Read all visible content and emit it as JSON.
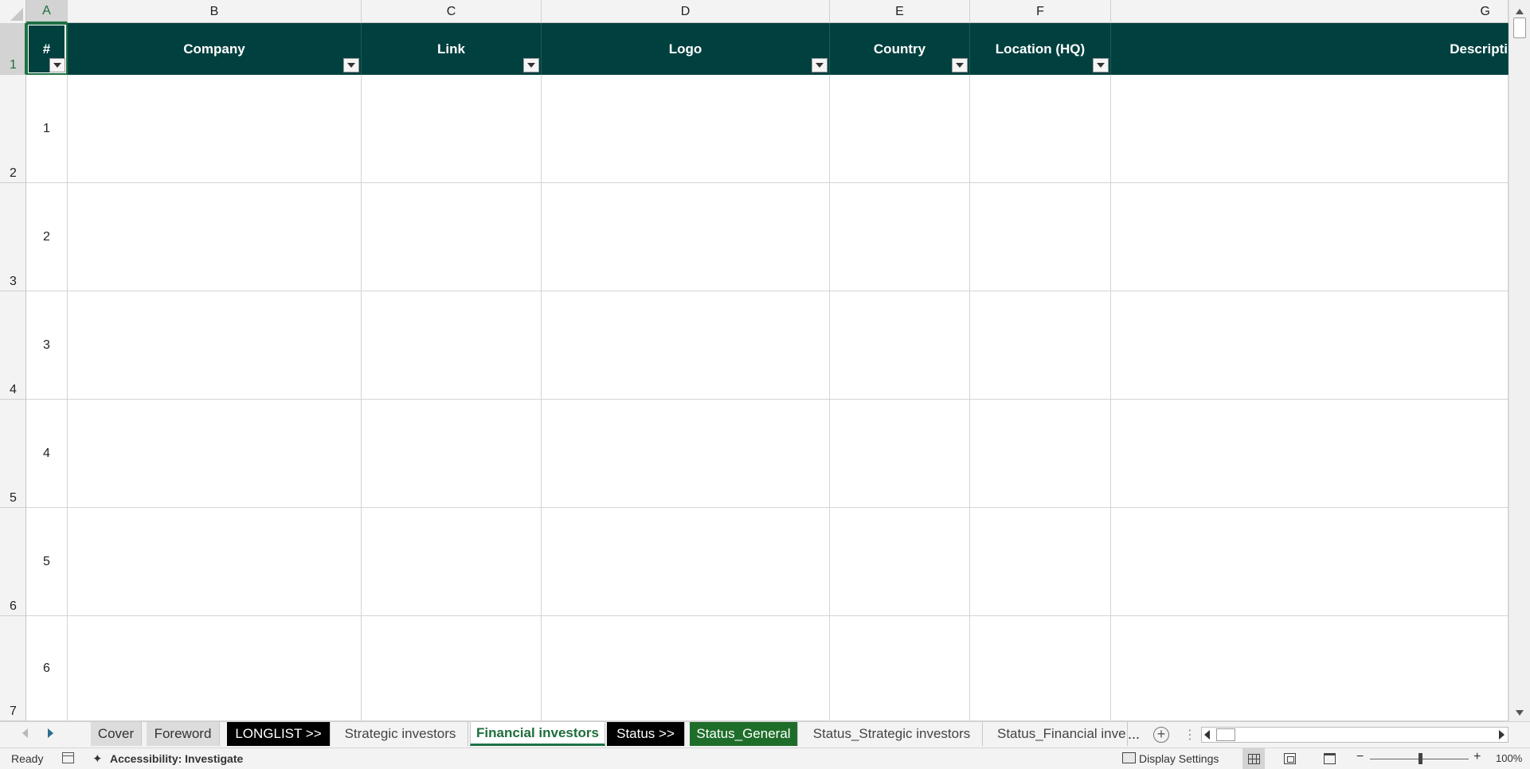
{
  "columns": [
    "A",
    "B",
    "C",
    "D",
    "E",
    "F",
    "G"
  ],
  "header_row": {
    "cells": [
      "#",
      "Company",
      "Link",
      "Logo",
      "Country",
      "Location (HQ)",
      "Descripti"
    ]
  },
  "row_numbers": [
    "1",
    "2",
    "3",
    "4",
    "5",
    "6",
    "7"
  ],
  "rows": [
    {
      "num": "1"
    },
    {
      "num": "2"
    },
    {
      "num": "3"
    },
    {
      "num": "4"
    },
    {
      "num": "5"
    },
    {
      "num": "6"
    }
  ],
  "sheet_tabs": [
    {
      "label": "Cover",
      "style": "grey"
    },
    {
      "label": "Foreword",
      "style": "grey"
    },
    {
      "label": "LONGLIST >>",
      "style": "black"
    },
    {
      "label": "Strategic investors",
      "style": "plain"
    },
    {
      "label": "Financial investors",
      "style": "active"
    },
    {
      "label": "Status >>",
      "style": "black"
    },
    {
      "label": "Status_General",
      "style": "green"
    },
    {
      "label": "Status_Strategic investors",
      "style": "plain"
    },
    {
      "label": "Status_Financial inve:",
      "style": "plain"
    }
  ],
  "tabbar": {
    "ellipsis": "...",
    "add_symbol": "+",
    "more_symbol": "⋮"
  },
  "status": {
    "ready": "Ready",
    "accessibility": "Accessibility: Investigate",
    "display_settings": "Display Settings",
    "zoom_level": "100%",
    "zoom_minus": "−",
    "zoom_plus": "+"
  },
  "colors": {
    "header_fill": "#00403f",
    "accent_green": "#1e7145",
    "tab_black": "#000000",
    "tab_green": "#1e6e2a"
  }
}
